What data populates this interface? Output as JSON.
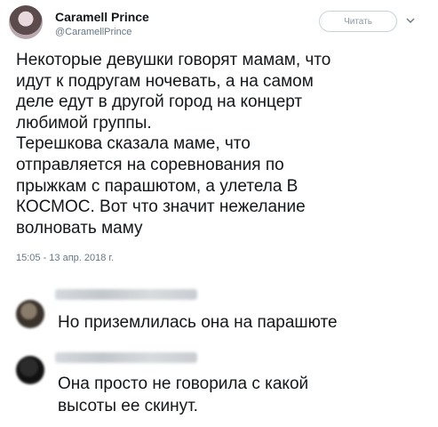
{
  "tweet": {
    "author": {
      "display_name": "Caramell Prince",
      "handle": "@CaramellPrince"
    },
    "follow_label": "Читать",
    "icons": {
      "avatar": "user-photo",
      "menu": "chevron-down-icon"
    },
    "text": "Некоторые девушки говорят мамам, что\nидут к подругам ночевать, а на самом\nделе едут в другой город на концерт\nлюбимой группы.\nТерешкова сказала маме, что\nотправляется на соревнования по\nпрыжкам с парашютом, а улетела В\nКОСМОС. Вот что значит нежелание\nволновать маму",
    "timestamp": "15:05 - 13 апр. 2018 г."
  },
  "replies": [
    {
      "text": "Но приземлилась она на парашюте"
    },
    {
      "text": "Она просто не говорила с какой\nвысоты ее скинут."
    }
  ],
  "colors": {
    "text": "#14171a",
    "secondary": "#657786",
    "border": "#c9d2d8"
  }
}
